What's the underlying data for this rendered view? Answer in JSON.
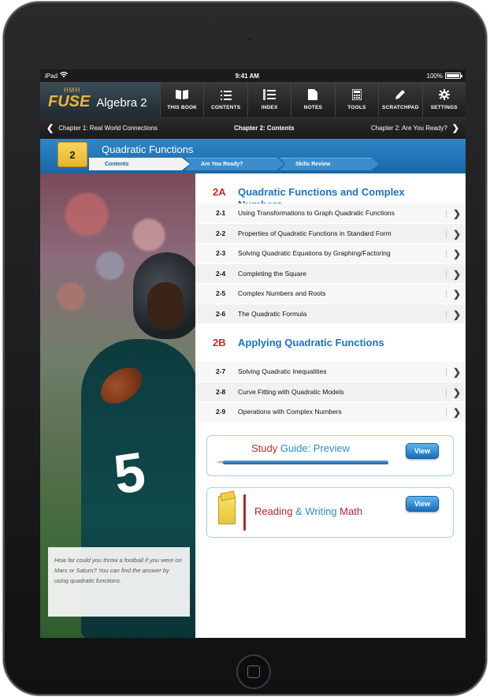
{
  "status": {
    "carrier": "iPad",
    "time": "9:41 AM",
    "battery": "100%",
    "battery_level": 1.0
  },
  "app": {
    "logo_small": "HMH",
    "logo_brand": "FUSE",
    "title": "Algebra 2"
  },
  "toolbar": [
    {
      "label": "THIS BOOK",
      "icon": "book-icon"
    },
    {
      "label": "CONTENTS",
      "icon": "list-icon"
    },
    {
      "label": "INDEX",
      "icon": "index-icon"
    },
    {
      "label": "NOTES",
      "icon": "notes-icon"
    },
    {
      "label": "TOOLS",
      "icon": "calculator-icon"
    },
    {
      "label": "SCRATCHPAD",
      "icon": "pencil-icon"
    },
    {
      "label": "SETTINGS",
      "icon": "gear-icon"
    }
  ],
  "chapter_nav": {
    "prev": "Chapter 1: Real World Connections",
    "current": "Chapter 2: Contents",
    "next": "Chapter 2: Are You Ready?"
  },
  "chapter": {
    "number": "2",
    "title": "Quadratic Functions",
    "tabs": [
      "Contents",
      "Are You Ready?",
      "Skills Review"
    ]
  },
  "caption": "How far could you throw a football if you were on Mars or Saturn? You can find the answer by using quadratic functions.",
  "jersey_number": "5",
  "sections": [
    {
      "code": "2A",
      "title": "Quadratic Functions and Complex Numbers",
      "lessons": [
        {
          "num": "2-1",
          "title": "Using Transformations to Graph Quadratic Functions"
        },
        {
          "num": "2-2",
          "title": "Properties of Quadratic Functions in Standard Form"
        },
        {
          "num": "2-3",
          "title": "Solving Quadratic Equations by Graphing/Factoring"
        },
        {
          "num": "2-4",
          "title": "Completing the Square"
        },
        {
          "num": "2-5",
          "title": "Complex Numbers and Roots"
        },
        {
          "num": "2-6",
          "title": "The Quadratic Formula"
        }
      ]
    },
    {
      "code": "2B",
      "title": "Applying Quadratic Functions",
      "lessons": [
        {
          "num": "2-7",
          "title": "Solving Quadratic Inequalities"
        },
        {
          "num": "2-8",
          "title": "Curve Fitting with Quadratic Models"
        },
        {
          "num": "2-9",
          "title": "Operations with Complex Numbers"
        }
      ]
    }
  ],
  "study_guide": {
    "title_a": "Study ",
    "title_b": "Guide: Preview",
    "button": "View"
  },
  "reading_math": {
    "title_a": "Reading ",
    "title_amp": "&",
    "title_b": " Writing ",
    "title_c": "Math",
    "button": "View"
  }
}
